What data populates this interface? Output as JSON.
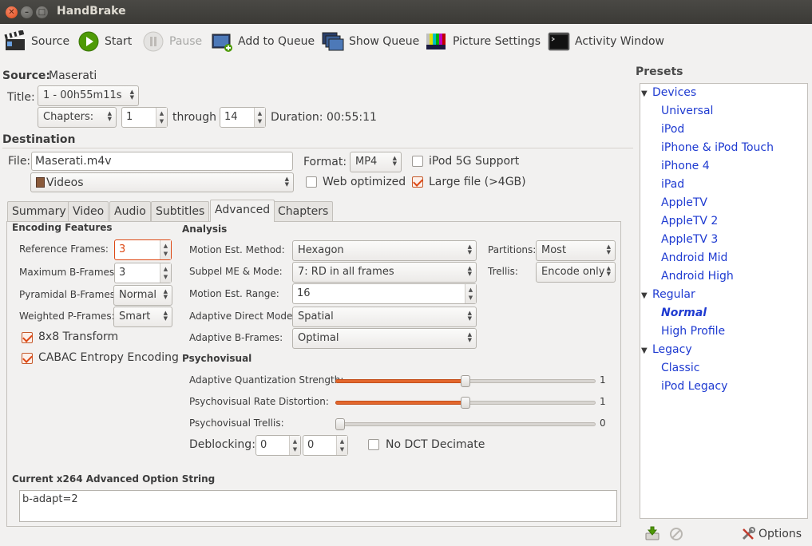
{
  "window": {
    "title": "HandBrake"
  },
  "toolbar": {
    "source": "Source",
    "start": "Start",
    "pause": "Pause",
    "add_to_queue": "Add to Queue",
    "show_queue": "Show Queue",
    "picture_settings": "Picture Settings",
    "activity_window": "Activity Window"
  },
  "source": {
    "label": "Source:",
    "name": "Maserati",
    "title_label": "Title:",
    "title_value": "1 - 00h55m11s",
    "chapters_mode": "Chapters:",
    "chapter_start": "1",
    "through": "through",
    "chapter_end": "14",
    "duration_label": "Duration:",
    "duration_value": "00:55:11"
  },
  "destination": {
    "label": "Destination",
    "file_label": "File:",
    "file_value": "Maserati.m4v",
    "folder": "Videos",
    "format_label": "Format:",
    "format_value": "MP4",
    "ipod_5g": "iPod 5G Support",
    "web_optimized": "Web optimized",
    "large_file": "Large file (>4GB)"
  },
  "tabs": [
    "Summary",
    "Video",
    "Audio",
    "Subtitles",
    "Advanced",
    "Chapters"
  ],
  "advanced": {
    "encoding_features": "Encoding Features",
    "ref_frames_label": "Reference Frames:",
    "ref_frames": "3",
    "max_bframes_label": "Maximum B-Frames:",
    "max_bframes": "3",
    "pyramidal_label": "Pyramidal B-Frames:",
    "pyramidal": "Normal",
    "weighted_label": "Weighted P-Frames:",
    "weighted": "Smart",
    "transform_8x8": "8x8 Transform",
    "cabac": "CABAC Entropy Encoding",
    "analysis": "Analysis",
    "me_method_label": "Motion Est. Method:",
    "me_method": "Hexagon",
    "subpel_label": "Subpel ME & Mode:",
    "subpel": "7: RD in all frames",
    "me_range_label": "Motion Est. Range:",
    "me_range": "16",
    "direct_label": "Adaptive Direct Mode:",
    "direct": "Spatial",
    "badapt_label": "Adaptive B-Frames:",
    "badapt": "Optimal",
    "partitions_label": "Partitions:",
    "partitions": "Most",
    "trellis_label": "Trellis:",
    "trellis": "Encode only",
    "psychovisual": "Psychovisual",
    "aq_label": "Adaptive Quantization Strength:",
    "aq_value": "1",
    "psyrd_label": "Psychovisual Rate Distortion:",
    "psyrd_value": "1",
    "psytrellis_label": "Psychovisual Trellis:",
    "psytrellis_value": "0",
    "deblock_label": "Deblocking:",
    "deblock_a": "0",
    "deblock_b": "0",
    "no_dct": "No DCT Decimate",
    "option_string_label": "Current x264 Advanced Option String",
    "option_string": "b-adapt=2",
    "slider_levels": {
      "aq": 0.5,
      "psyrd": 0.5,
      "psytrellis": 0.0
    }
  },
  "presets": {
    "title": "Presets",
    "groups": [
      {
        "name": "Devices",
        "items": [
          "Universal",
          "iPod",
          "iPhone & iPod Touch",
          "iPhone 4",
          "iPad",
          "AppleTV",
          "AppleTV 2",
          "AppleTV 3",
          "Android Mid",
          "Android High"
        ]
      },
      {
        "name": "Regular",
        "items": [
          "Normal",
          "High Profile"
        ]
      },
      {
        "name": "Legacy",
        "items": [
          "Classic",
          "iPod Legacy"
        ]
      }
    ],
    "options": "Options"
  },
  "colors": {
    "accent": "#dd4814",
    "link": "#1f3bd1",
    "titlebar": "#3c3b37"
  }
}
